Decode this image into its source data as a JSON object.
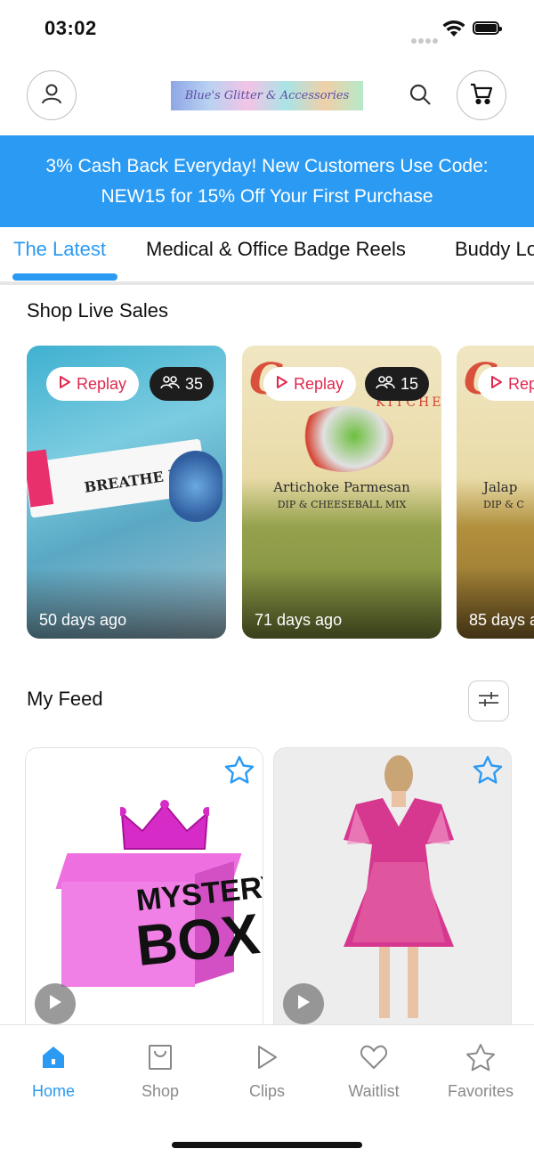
{
  "status_bar": {
    "time": "03:02"
  },
  "header": {
    "logo_text": "Blue's Glitter & Accessories",
    "account_icon": "person-icon",
    "search_icon": "search-icon",
    "cart_icon": "cart-icon"
  },
  "promo": {
    "line1": "3% Cash Back Everyday! New Customers Use Code:",
    "line2": "NEW15 for 15% Off Your First Purchase"
  },
  "tabs": [
    {
      "label": "The Latest",
      "active": true
    },
    {
      "label": "Medical & Office Badge Reels",
      "active": false
    },
    {
      "label": "Buddy Lo",
      "active": false
    }
  ],
  "live_sales": {
    "title": "Shop Live Sales",
    "cards": [
      {
        "replay_label": "Replay",
        "viewers": "35",
        "days_ago": "50 days ago",
        "art_text": "BREATHE EASY"
      },
      {
        "replay_label": "Replay",
        "viewers": "15",
        "days_ago": "71 days ago",
        "art_brand": "C",
        "art_sub": "KITCHEN",
        "art_text": "Artichoke Parmesan",
        "art_sub2": "DIP & CHEESEBALL MIX"
      },
      {
        "replay_label": "Rep",
        "days_ago": "85 days a",
        "art_brand": "C",
        "art_text": "Jalap",
        "art_sub2": "DIP & C"
      }
    ]
  },
  "feed": {
    "title": "My Feed",
    "filter_icon": "sliders-icon",
    "items": [
      {
        "art_word1": "MYSTERY",
        "art_word2": "BOX",
        "favorite_icon": "star-icon",
        "play_icon": "play-icon"
      },
      {
        "favorite_icon": "star-icon",
        "play_icon": "play-icon"
      }
    ]
  },
  "bottom_nav": [
    {
      "label": "Home",
      "icon": "home-icon",
      "active": true
    },
    {
      "label": "Shop",
      "icon": "shop-bag-icon",
      "active": false
    },
    {
      "label": "Clips",
      "icon": "play-outline-icon",
      "active": false
    },
    {
      "label": "Waitlist",
      "icon": "heart-icon",
      "active": false
    },
    {
      "label": "Favorites",
      "icon": "star-outline-icon",
      "active": false
    }
  ],
  "colors": {
    "accent": "#2a9af3",
    "replay_red": "#e0284e",
    "promo_bg": "#2a9af3"
  }
}
